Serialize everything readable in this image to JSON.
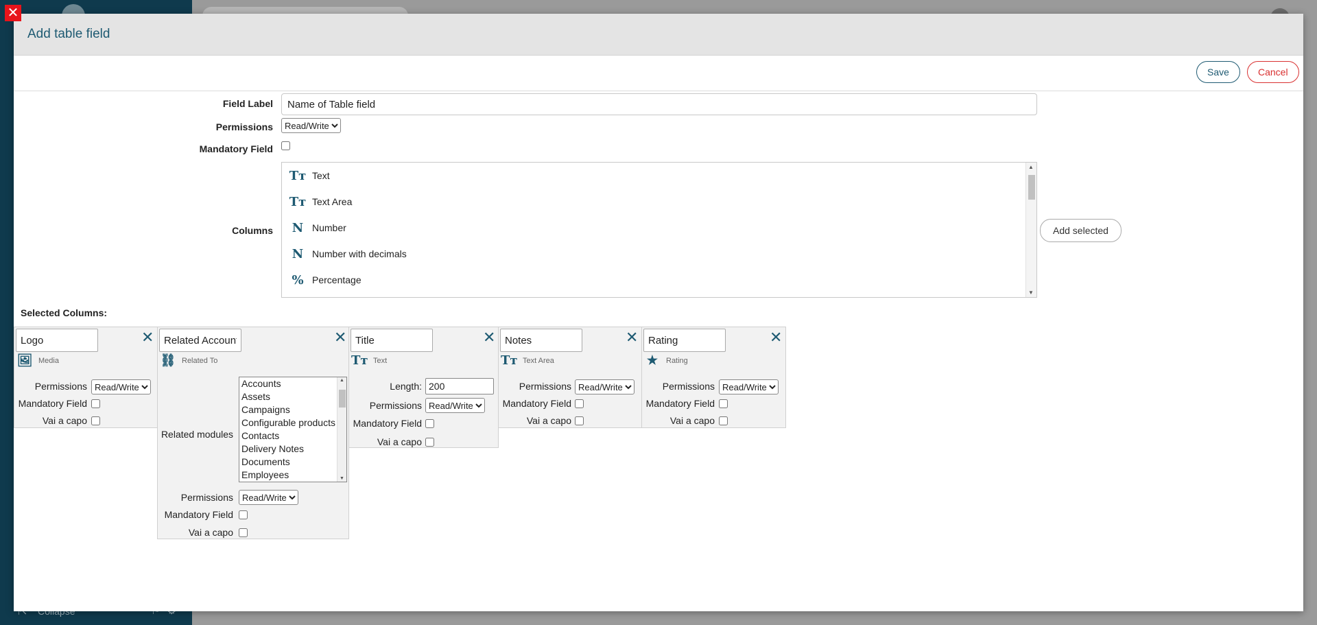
{
  "background": {
    "sidebar_collapse": "Collapse"
  },
  "modal": {
    "title": "Add table field",
    "save_label": "Save",
    "cancel_label": "Cancel",
    "close_symbol": "✕"
  },
  "form": {
    "field_label_label": "Field Label",
    "field_label_value": "Name of Table field",
    "permissions_label": "Permissions",
    "permissions_value": "Read/Write",
    "mandatory_label": "Mandatory Field",
    "columns_label": "Columns",
    "add_selected_label": "Add selected",
    "columns": [
      {
        "icon": "text-icon",
        "glyph": "Tт",
        "label": "Text"
      },
      {
        "icon": "text-area-icon",
        "glyph": "Tт",
        "label": "Text Area"
      },
      {
        "icon": "number-icon",
        "glyph": "N",
        "label": "Number"
      },
      {
        "icon": "number-decimals-icon",
        "glyph": "N",
        "label": "Number with decimals"
      },
      {
        "icon": "percentage-icon",
        "glyph": "%",
        "label": "Percentage"
      }
    ]
  },
  "selected": {
    "label": "Selected Columns:",
    "permissions_label": "Permissions",
    "mandatory_label": "Mandatory Field",
    "newline_label": "Vai a capo",
    "permissions_value": "Read/Write",
    "cards": [
      {
        "name": "Logo",
        "type": "Media",
        "icon": "media-icon"
      },
      {
        "name": "Related Account",
        "type": "Related To",
        "icon": "link-icon",
        "related_modules_label": "Related modules",
        "modules": [
          "Accounts",
          "Assets",
          "Campaigns",
          "Configurable products",
          "Contacts",
          "Delivery Notes",
          "Documents",
          "Employees"
        ]
      },
      {
        "name": "Title",
        "type": "Text",
        "icon": "text-icon",
        "length_label": "Length:",
        "length_value": "200"
      },
      {
        "name": "Notes",
        "type": "Text Area",
        "icon": "text-area-icon"
      },
      {
        "name": "Rating",
        "type": "Rating",
        "icon": "star-icon"
      }
    ]
  },
  "colors": {
    "accent": "#1e5a72",
    "danger": "#d93030",
    "close_red": "#e8141b"
  }
}
